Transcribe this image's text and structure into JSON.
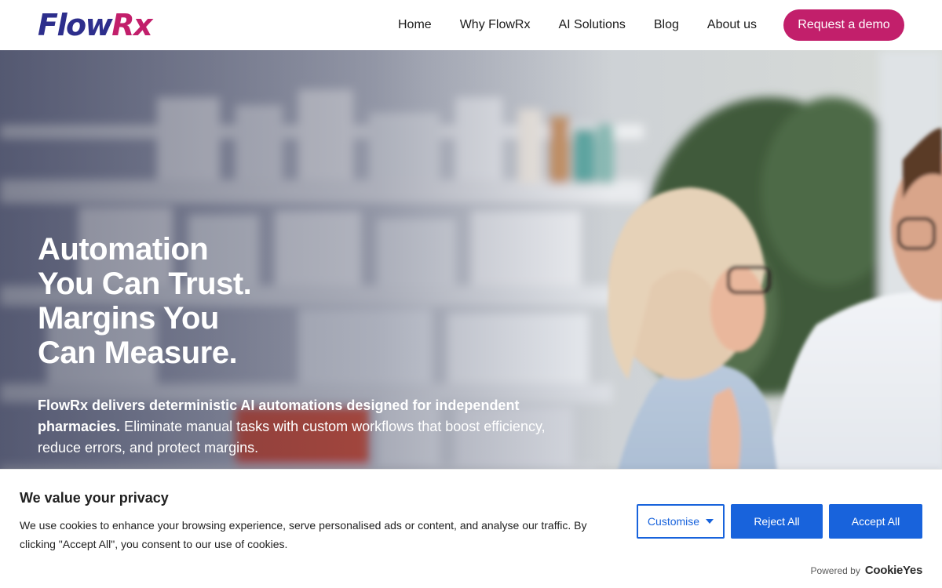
{
  "header": {
    "logo": {
      "part1": "Flow",
      "part2": "Rx"
    },
    "nav": [
      "Home",
      "Why FlowRx",
      "AI Solutions",
      "Blog",
      "About us"
    ],
    "cta": "Request a demo"
  },
  "hero": {
    "title_lines": [
      "Automation",
      "You Can Trust.",
      "Margins You",
      "Can Measure."
    ],
    "desc_bold": "FlowRx delivers deterministic AI automations designed for independent pharmacies.",
    "desc_rest": " Eliminate manual tasks with custom workflows that boost efficiency, reduce errors, and protect margins."
  },
  "cookie": {
    "title": "We value your privacy",
    "text": "We use cookies to enhance your browsing experience, serve personalised ads or content, and analyse our traffic. By clicking \"Accept All\", you consent to our use of cookies.",
    "customise": "Customise",
    "reject": "Reject All",
    "accept": "Accept All",
    "powered_by": "Powered by",
    "powered_logo": "CookieYes"
  },
  "colors": {
    "brand_primary": "#2d2e8c",
    "brand_accent": "#c21f6b",
    "cookie_button": "#1863dc"
  },
  "icons": {
    "customise_caret": "caret-down-icon"
  }
}
